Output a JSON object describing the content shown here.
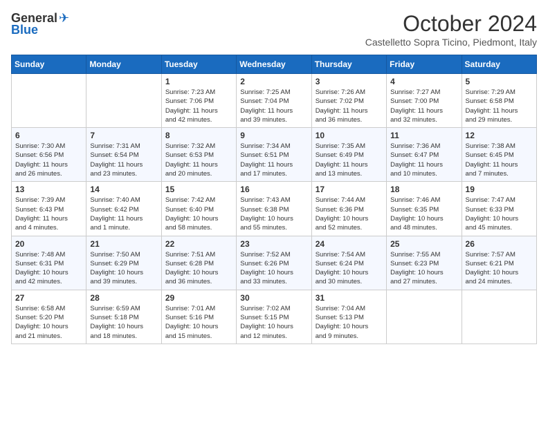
{
  "header": {
    "logo_general": "General",
    "logo_blue": "Blue",
    "month_title": "October 2024",
    "subtitle": "Castelletto Sopra Ticino, Piedmont, Italy"
  },
  "days_of_week": [
    "Sunday",
    "Monday",
    "Tuesday",
    "Wednesday",
    "Thursday",
    "Friday",
    "Saturday"
  ],
  "weeks": [
    [
      {
        "day": "",
        "info": ""
      },
      {
        "day": "",
        "info": ""
      },
      {
        "day": "1",
        "info": "Sunrise: 7:23 AM\nSunset: 7:06 PM\nDaylight: 11 hours\nand 42 minutes."
      },
      {
        "day": "2",
        "info": "Sunrise: 7:25 AM\nSunset: 7:04 PM\nDaylight: 11 hours\nand 39 minutes."
      },
      {
        "day": "3",
        "info": "Sunrise: 7:26 AM\nSunset: 7:02 PM\nDaylight: 11 hours\nand 36 minutes."
      },
      {
        "day": "4",
        "info": "Sunrise: 7:27 AM\nSunset: 7:00 PM\nDaylight: 11 hours\nand 32 minutes."
      },
      {
        "day": "5",
        "info": "Sunrise: 7:29 AM\nSunset: 6:58 PM\nDaylight: 11 hours\nand 29 minutes."
      }
    ],
    [
      {
        "day": "6",
        "info": "Sunrise: 7:30 AM\nSunset: 6:56 PM\nDaylight: 11 hours\nand 26 minutes."
      },
      {
        "day": "7",
        "info": "Sunrise: 7:31 AM\nSunset: 6:54 PM\nDaylight: 11 hours\nand 23 minutes."
      },
      {
        "day": "8",
        "info": "Sunrise: 7:32 AM\nSunset: 6:53 PM\nDaylight: 11 hours\nand 20 minutes."
      },
      {
        "day": "9",
        "info": "Sunrise: 7:34 AM\nSunset: 6:51 PM\nDaylight: 11 hours\nand 17 minutes."
      },
      {
        "day": "10",
        "info": "Sunrise: 7:35 AM\nSunset: 6:49 PM\nDaylight: 11 hours\nand 13 minutes."
      },
      {
        "day": "11",
        "info": "Sunrise: 7:36 AM\nSunset: 6:47 PM\nDaylight: 11 hours\nand 10 minutes."
      },
      {
        "day": "12",
        "info": "Sunrise: 7:38 AM\nSunset: 6:45 PM\nDaylight: 11 hours\nand 7 minutes."
      }
    ],
    [
      {
        "day": "13",
        "info": "Sunrise: 7:39 AM\nSunset: 6:43 PM\nDaylight: 11 hours\nand 4 minutes."
      },
      {
        "day": "14",
        "info": "Sunrise: 7:40 AM\nSunset: 6:42 PM\nDaylight: 11 hours\nand 1 minute."
      },
      {
        "day": "15",
        "info": "Sunrise: 7:42 AM\nSunset: 6:40 PM\nDaylight: 10 hours\nand 58 minutes."
      },
      {
        "day": "16",
        "info": "Sunrise: 7:43 AM\nSunset: 6:38 PM\nDaylight: 10 hours\nand 55 minutes."
      },
      {
        "day": "17",
        "info": "Sunrise: 7:44 AM\nSunset: 6:36 PM\nDaylight: 10 hours\nand 52 minutes."
      },
      {
        "day": "18",
        "info": "Sunrise: 7:46 AM\nSunset: 6:35 PM\nDaylight: 10 hours\nand 48 minutes."
      },
      {
        "day": "19",
        "info": "Sunrise: 7:47 AM\nSunset: 6:33 PM\nDaylight: 10 hours\nand 45 minutes."
      }
    ],
    [
      {
        "day": "20",
        "info": "Sunrise: 7:48 AM\nSunset: 6:31 PM\nDaylight: 10 hours\nand 42 minutes."
      },
      {
        "day": "21",
        "info": "Sunrise: 7:50 AM\nSunset: 6:29 PM\nDaylight: 10 hours\nand 39 minutes."
      },
      {
        "day": "22",
        "info": "Sunrise: 7:51 AM\nSunset: 6:28 PM\nDaylight: 10 hours\nand 36 minutes."
      },
      {
        "day": "23",
        "info": "Sunrise: 7:52 AM\nSunset: 6:26 PM\nDaylight: 10 hours\nand 33 minutes."
      },
      {
        "day": "24",
        "info": "Sunrise: 7:54 AM\nSunset: 6:24 PM\nDaylight: 10 hours\nand 30 minutes."
      },
      {
        "day": "25",
        "info": "Sunrise: 7:55 AM\nSunset: 6:23 PM\nDaylight: 10 hours\nand 27 minutes."
      },
      {
        "day": "26",
        "info": "Sunrise: 7:57 AM\nSunset: 6:21 PM\nDaylight: 10 hours\nand 24 minutes."
      }
    ],
    [
      {
        "day": "27",
        "info": "Sunrise: 6:58 AM\nSunset: 5:20 PM\nDaylight: 10 hours\nand 21 minutes."
      },
      {
        "day": "28",
        "info": "Sunrise: 6:59 AM\nSunset: 5:18 PM\nDaylight: 10 hours\nand 18 minutes."
      },
      {
        "day": "29",
        "info": "Sunrise: 7:01 AM\nSunset: 5:16 PM\nDaylight: 10 hours\nand 15 minutes."
      },
      {
        "day": "30",
        "info": "Sunrise: 7:02 AM\nSunset: 5:15 PM\nDaylight: 10 hours\nand 12 minutes."
      },
      {
        "day": "31",
        "info": "Sunrise: 7:04 AM\nSunset: 5:13 PM\nDaylight: 10 hours\nand 9 minutes."
      },
      {
        "day": "",
        "info": ""
      },
      {
        "day": "",
        "info": ""
      }
    ]
  ]
}
